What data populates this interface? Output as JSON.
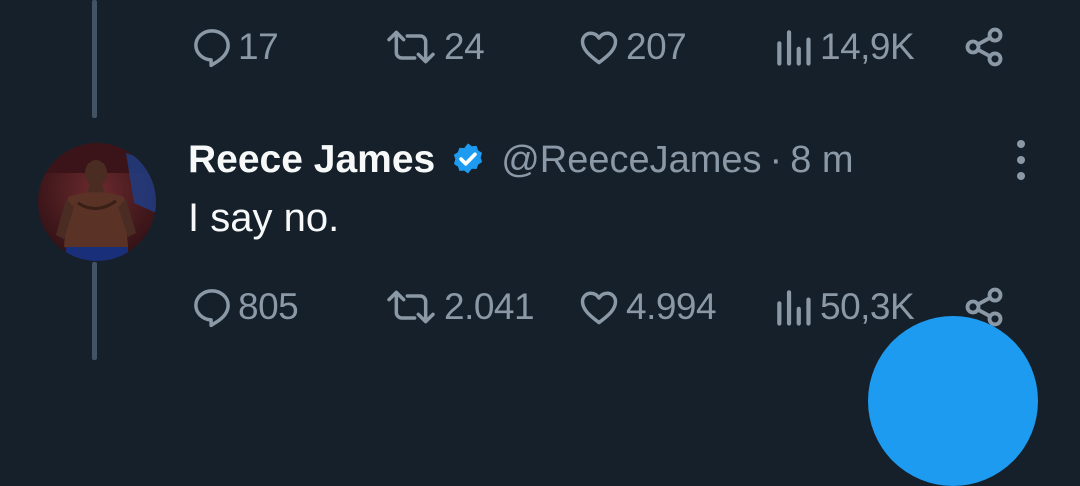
{
  "previous_tweet": {
    "actions": {
      "replies": "17",
      "retweets": "24",
      "likes": "207",
      "views": "14,9K"
    }
  },
  "tweet": {
    "author": {
      "display_name": "Reece James",
      "handle": "@ReeceJames",
      "verified": true
    },
    "separator": "·",
    "time": "8 m",
    "text": "I say no.",
    "actions": {
      "replies": "805",
      "retweets": "2.041",
      "likes": "4.994",
      "views": "50,3K"
    }
  },
  "colors": {
    "background": "#15202b",
    "secondary_text": "#8b98a5",
    "accent": "#1d9bf0"
  },
  "icons": [
    "reply-icon",
    "retweet-icon",
    "like-icon",
    "views-icon",
    "share-icon",
    "verified-icon",
    "more-icon"
  ]
}
